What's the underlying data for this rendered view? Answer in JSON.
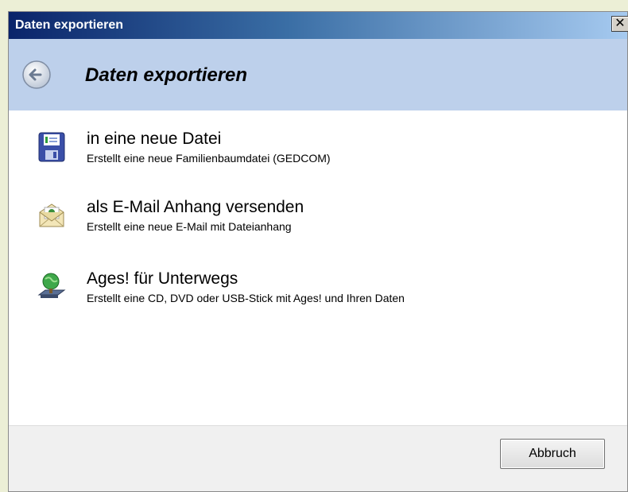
{
  "window": {
    "title": "Daten exportieren",
    "close_glyph": "✕"
  },
  "header": {
    "heading": "Daten exportieren",
    "back_icon": "back-arrow-icon"
  },
  "options": [
    {
      "label": "in eine neue Datei",
      "description": "Erstellt eine neue Familienbaumdatei (GEDCOM)",
      "icon": "floppy-disk-icon"
    },
    {
      "label": "als E-Mail Anhang versenden",
      "description": "Erstellt eine neue E-Mail mit Dateianhang",
      "icon": "email-envelope-icon"
    },
    {
      "label": "Ages! für Unterwegs",
      "description": "Erstellt eine CD, DVD oder USB-Stick mit Ages! und Ihren Daten",
      "icon": "globe-laptop-icon"
    }
  ],
  "footer": {
    "cancel_label": "Abbruch"
  },
  "colors": {
    "titlebar_start": "#0a246a",
    "titlebar_end": "#a6caf0",
    "header_bg": "#bdd0eb"
  }
}
